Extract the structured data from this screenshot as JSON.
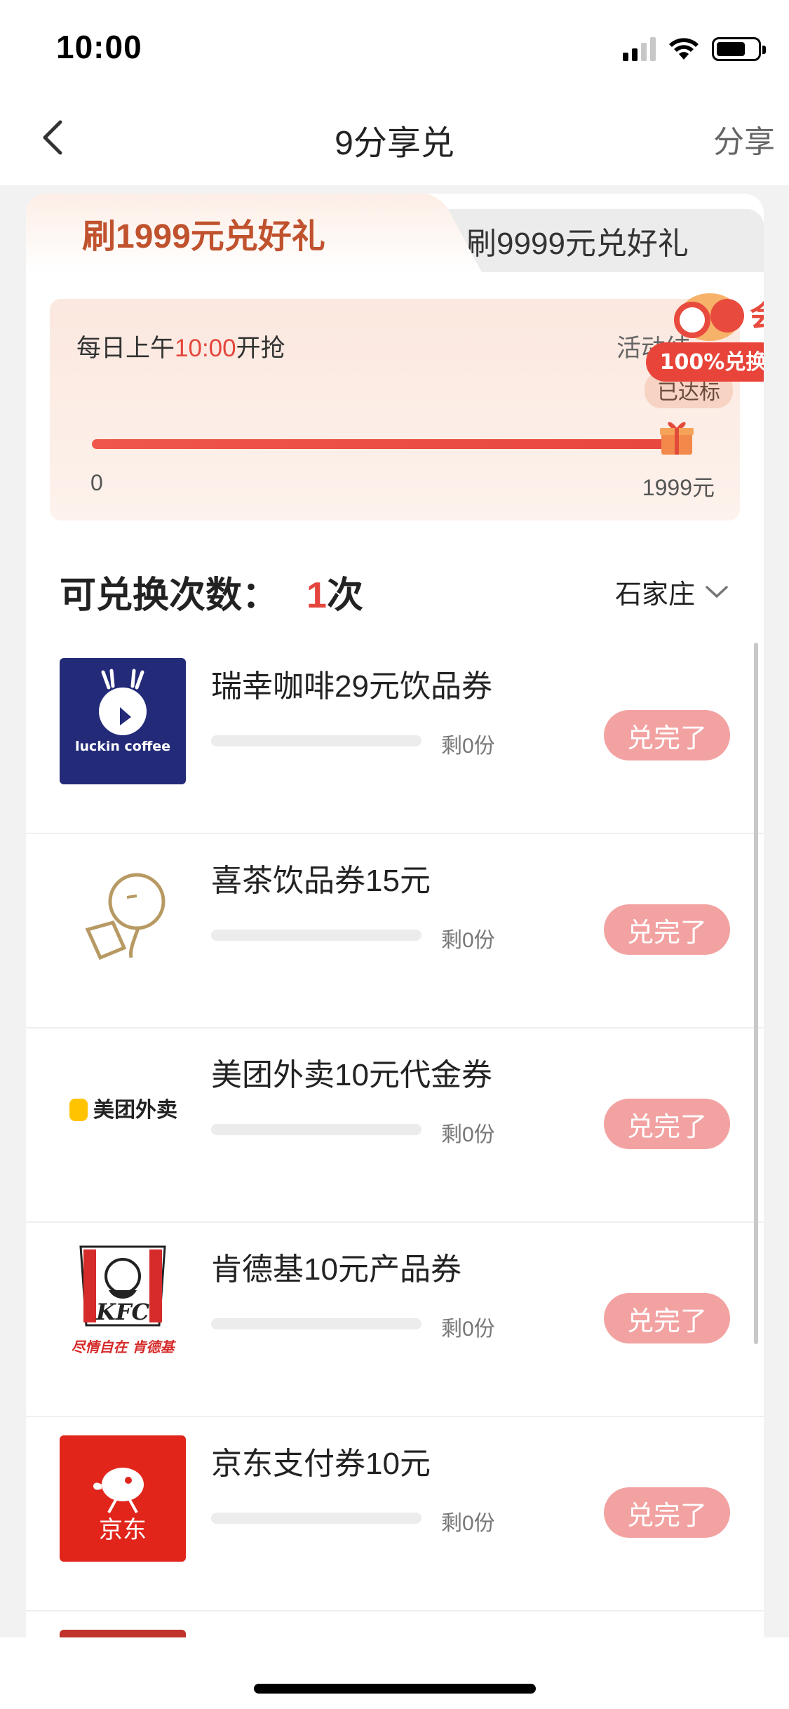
{
  "status_bar": {
    "time": "10:00"
  },
  "nav": {
    "title": "9分享兑",
    "share_label": "分享"
  },
  "tabs": [
    {
      "label": "刷1999元兑好礼",
      "active": true
    },
    {
      "label": "刷9999元兑好礼",
      "active": false
    }
  ],
  "progress": {
    "daily_prefix": "每日上午",
    "daily_time": "10:00",
    "daily_suffix": "开抢",
    "activity_text": "活动结",
    "reached_badge": "已达标",
    "min_label": "0",
    "max_label": "1999元",
    "fraction": 1.0,
    "promo_badge_text": "100%兑换",
    "promo_badge_glyph": "会"
  },
  "redeem": {
    "label": "可兑换次数：",
    "count": "1",
    "unit": "次",
    "city": "石家庄"
  },
  "items": [
    {
      "title": "瑞幸咖啡29元饮品券",
      "remain": "剩0份",
      "button": "兑完了",
      "logo_text": "luckin coffee",
      "logo_bg": "#232a78"
    },
    {
      "title": "喜茶饮品券15元",
      "remain": "剩0份",
      "button": "兑完了",
      "logo_bg": "#ffffff"
    },
    {
      "title": "美团外卖10元代金券",
      "remain": "剩0份",
      "button": "兑完了",
      "logo_text": "美团外卖",
      "logo_bg": "#ffffff"
    },
    {
      "title": "肯德基10元产品券",
      "remain": "剩0份",
      "button": "兑完了",
      "logo_text": "KFC",
      "logo_subtext": "尽情自在 肯德基",
      "logo_bg": "#ffffff"
    },
    {
      "title": "京东支付券10元",
      "remain": "剩0份",
      "button": "兑完了",
      "logo_text": "京东",
      "logo_bg": "#e1251b"
    }
  ],
  "colors": {
    "accent": "#e4463d",
    "tab_active_text": "#c0522e",
    "button_disabled": "#f3a2a2"
  }
}
